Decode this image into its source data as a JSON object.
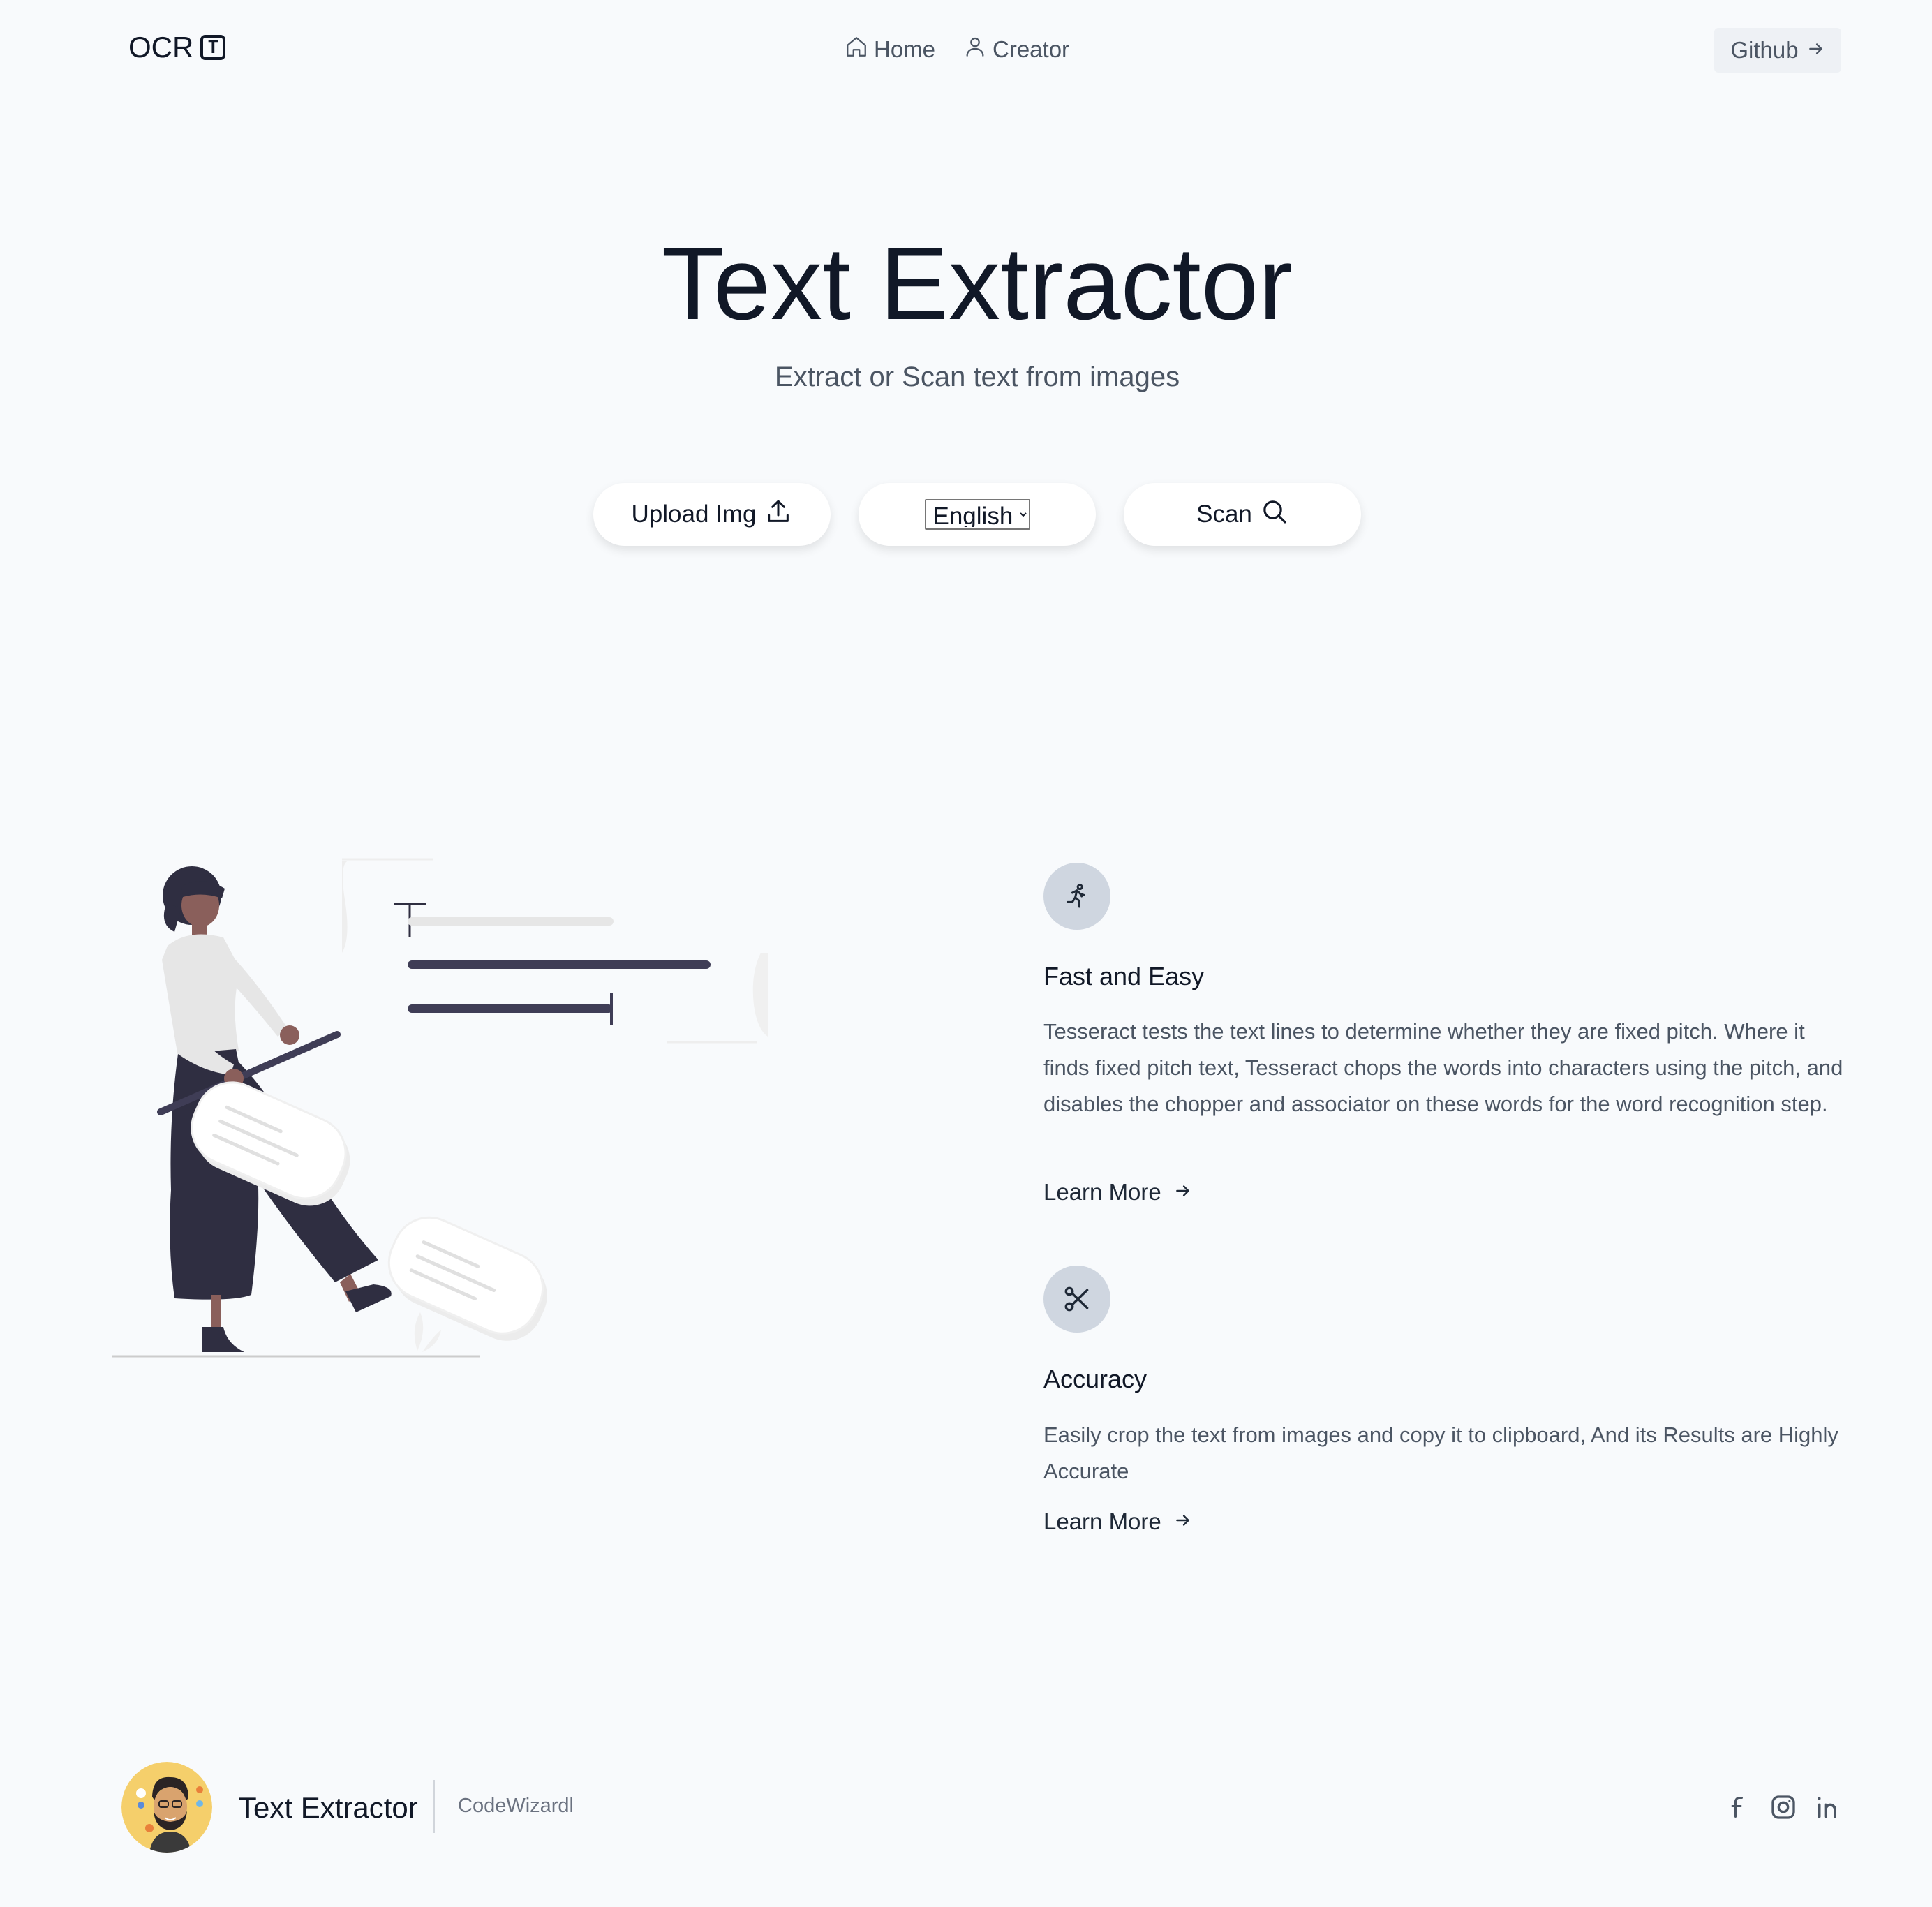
{
  "header": {
    "logo_text": "OCR",
    "logo_badge": "T",
    "nav": [
      {
        "label": "Home",
        "icon": "home-icon"
      },
      {
        "label": "Creator",
        "icon": "user-icon"
      }
    ],
    "github_label": "Github"
  },
  "hero": {
    "title": "Text Extractor",
    "subtitle": "Extract or Scan text from images"
  },
  "actions": {
    "upload_label": "Upload Img",
    "language": {
      "selected": "English",
      "options": [
        "English"
      ]
    },
    "scan_label": "Scan"
  },
  "features": [
    {
      "icon": "running-person-icon",
      "title": "Fast and Easy",
      "description": "Tesseract tests the text lines to determine whether they are fixed pitch. Where it finds fixed pitch text, Tesseract chops the words into characters using the pitch, and disables the chopper and associator on these words for the word recognition step.",
      "link_label": "Learn More"
    },
    {
      "icon": "scissors-icon",
      "title": "Accuracy",
      "description": "Easily crop the text from images and copy it to clipboard, And its Results are Highly Accurate",
      "link_label": "Learn More"
    }
  ],
  "footer": {
    "title": "Text Extractor",
    "author": "CodeWizardl",
    "social": [
      "facebook-icon",
      "instagram-icon",
      "linkedin-icon"
    ]
  },
  "colors": {
    "background": "#f8fafc",
    "text_primary": "#111827",
    "text_secondary": "#4b5563",
    "icon_circle": "#cfd6e0",
    "illustration_dark": "#2f2e41",
    "skin": "#8a5f5b"
  }
}
